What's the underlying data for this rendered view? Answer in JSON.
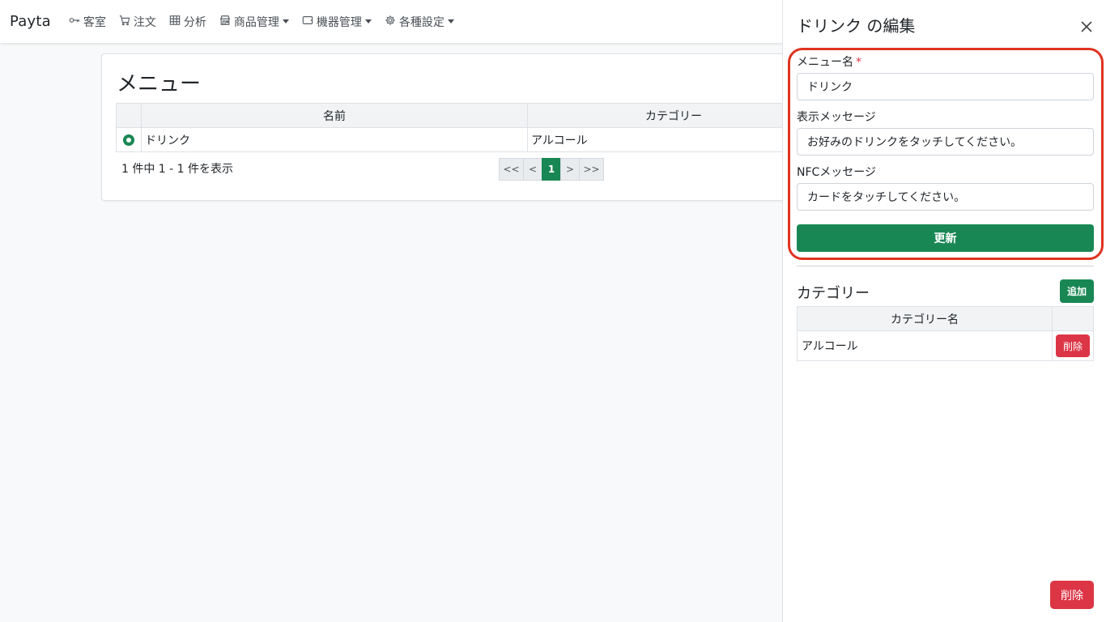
{
  "navbar": {
    "brand": "Payta",
    "items": [
      {
        "label": "客室",
        "icon": "key-icon",
        "dropdown": false
      },
      {
        "label": "注文",
        "icon": "cart-icon",
        "dropdown": false
      },
      {
        "label": "分析",
        "icon": "table-icon",
        "dropdown": false
      },
      {
        "label": "商品管理",
        "icon": "shop-icon",
        "dropdown": true
      },
      {
        "label": "機器管理",
        "icon": "tablet-icon",
        "dropdown": true
      },
      {
        "label": "各種設定",
        "icon": "gear-icon",
        "dropdown": true
      }
    ]
  },
  "menu_card": {
    "title": "メニュー",
    "columns": [
      "",
      "名前",
      "カテゴリー"
    ],
    "rows": [
      {
        "selected": true,
        "name": "ドリンク",
        "category": "アルコール"
      }
    ],
    "summary": "1 件中 1 - 1 件を表示",
    "pagination": {
      "first": "<<",
      "prev": "<",
      "current": "1",
      "next": ">",
      "last": ">>"
    }
  },
  "edit_panel": {
    "title": "ドリンク の編集",
    "fields": {
      "menu_name": {
        "label": "メニュー名",
        "required_mark": "*",
        "value": "ドリンク"
      },
      "display_message": {
        "label": "表示メッセージ",
        "value": "お好みのドリンクをタッチしてください。"
      },
      "nfc_message": {
        "label": "NFCメッセージ",
        "value": "カードをタッチしてください。"
      }
    },
    "update_button": "更新",
    "category_section": {
      "heading": "カテゴリー",
      "add_button": "追加",
      "column": "カテゴリー名",
      "rows": [
        {
          "name": "アルコール",
          "delete_label": "削除"
        }
      ]
    },
    "delete_button": "削除"
  },
  "colors": {
    "primary_green": "#198754",
    "danger_red": "#dc3545",
    "highlight_red": "#e0321f",
    "page_background": "#f8f9fa"
  }
}
